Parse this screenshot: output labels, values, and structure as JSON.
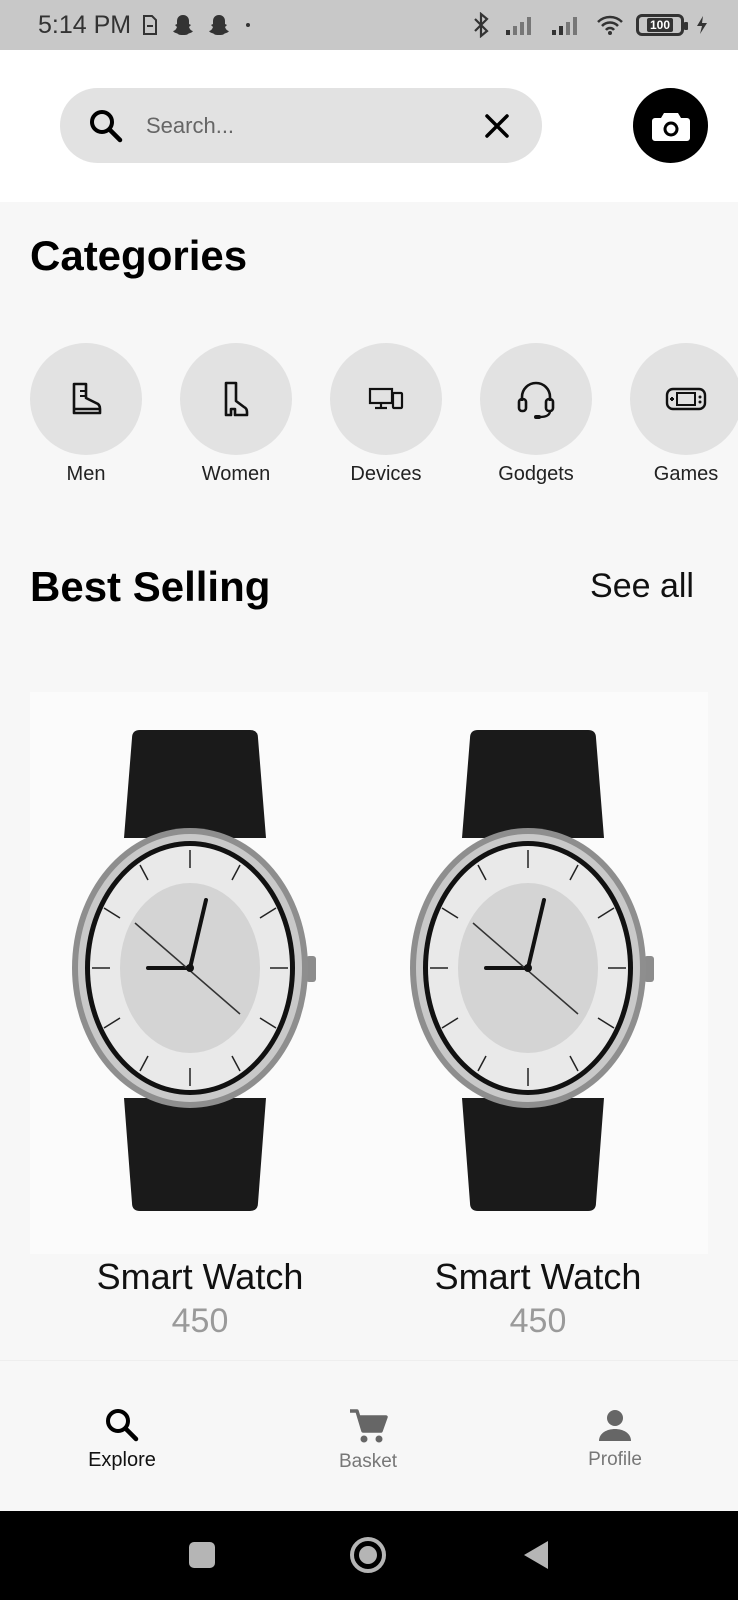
{
  "status_bar": {
    "time": "5:14 PM",
    "battery": "100"
  },
  "search": {
    "placeholder": "Search...",
    "value": ""
  },
  "categories": {
    "title": "Categories",
    "items": [
      {
        "label": "Men",
        "icon": "boot-icon"
      },
      {
        "label": "Women",
        "icon": "heel-boot-icon"
      },
      {
        "label": "Devices",
        "icon": "devices-icon"
      },
      {
        "label": "Godgets",
        "icon": "headset-icon"
      },
      {
        "label": "Games",
        "icon": "gamepad-icon"
      }
    ]
  },
  "best_selling": {
    "title": "Best Selling",
    "see_all": "See all",
    "products": [
      {
        "name": "Smart Watch",
        "price": "450",
        "image": "watch-image"
      },
      {
        "name": "Smart Watch",
        "price": "450",
        "image": "watch-image"
      }
    ]
  },
  "bottom_nav": {
    "items": [
      {
        "label": "Explore",
        "icon": "search-icon",
        "active": true
      },
      {
        "label": "Basket",
        "icon": "cart-icon",
        "active": false
      },
      {
        "label": "Profile",
        "icon": "person-icon",
        "active": false
      }
    ]
  },
  "colors": {
    "background": "#f7f7f7",
    "surface": "#ffffff",
    "chip": "#e2e2e2",
    "accent": "#000000",
    "price": "#9a9a9a"
  }
}
